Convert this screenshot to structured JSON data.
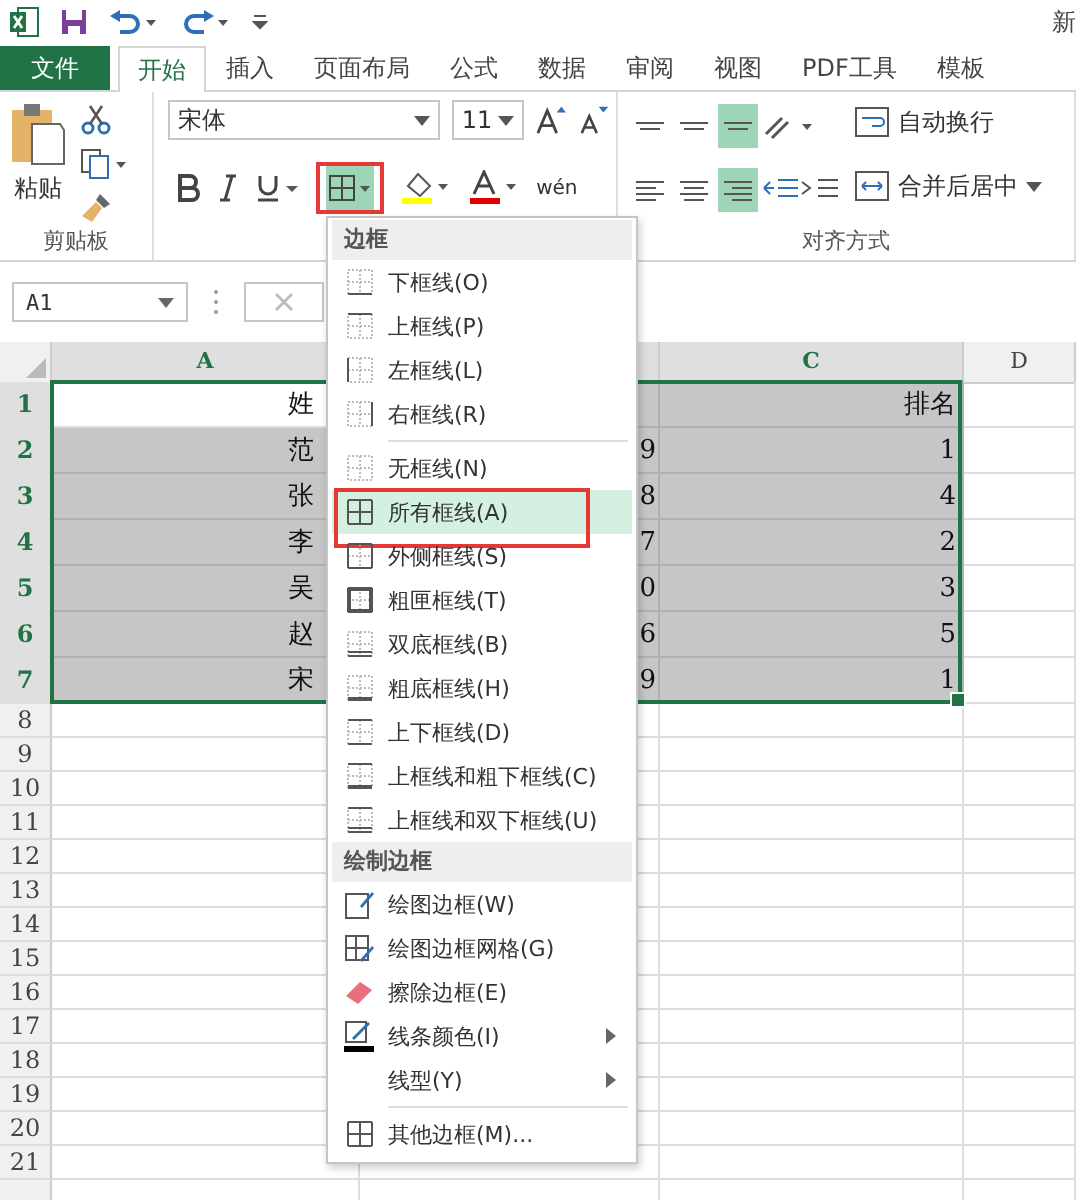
{
  "title_bar": {
    "title": "新"
  },
  "ribbon_tabs": [
    {
      "label": "文件",
      "kind": "file",
      "selected": false
    },
    {
      "label": "开始",
      "kind": "tab",
      "selected": true
    },
    {
      "label": "插入",
      "kind": "tab",
      "selected": false
    },
    {
      "label": "页面布局",
      "kind": "tab",
      "selected": false
    },
    {
      "label": "公式",
      "kind": "tab",
      "selected": false
    },
    {
      "label": "数据",
      "kind": "tab",
      "selected": false
    },
    {
      "label": "审阅",
      "kind": "tab",
      "selected": false
    },
    {
      "label": "视图",
      "kind": "tab",
      "selected": false
    },
    {
      "label": "PDF工具",
      "kind": "tab",
      "selected": false
    },
    {
      "label": "模板",
      "kind": "tab",
      "selected": false
    }
  ],
  "ribbon": {
    "paste_label": "粘贴",
    "clipboard_label": "剪贴板",
    "font_name": "宋体",
    "font_size": "11",
    "phonetic_label": "wén",
    "border_button": {
      "on": true,
      "marked": true
    },
    "align_buttons": [
      {
        "kind": "top",
        "on": false
      },
      {
        "kind": "middle",
        "on": false
      },
      {
        "kind": "bottom",
        "on": true
      },
      {
        "kind": "left",
        "on": false
      },
      {
        "kind": "center",
        "on": false
      },
      {
        "kind": "right",
        "on": true
      }
    ],
    "wrap_text": "自动换行",
    "merge_center": "合并后居中",
    "alignment_label": "对齐方式"
  },
  "name_box": {
    "value": "A1"
  },
  "sheet": {
    "columns": [
      {
        "label": "A",
        "selected": true
      },
      {
        "selected": true
      },
      {
        "label": "C",
        "selected": true
      },
      {
        "label": "D",
        "selected": false
      }
    ],
    "rows": [
      {
        "label": "1",
        "selected": true,
        "cells": [
          {
            "text": "姓",
            "selected": false
          },
          {
            "selected": true
          },
          {
            "text": "排名",
            "selected": true
          }
        ]
      },
      {
        "label": "2",
        "selected": true,
        "cells": [
          {
            "text": "范",
            "selected": true
          },
          {
            "text": "9",
            "selected": true
          },
          {
            "text": "1",
            "selected": true
          }
        ]
      },
      {
        "label": "3",
        "selected": true,
        "cells": [
          {
            "text": "张",
            "selected": true
          },
          {
            "text": "8",
            "selected": true
          },
          {
            "text": "4",
            "selected": true
          }
        ]
      },
      {
        "label": "4",
        "selected": true,
        "cells": [
          {
            "text": "李",
            "selected": true
          },
          {
            "text": "7",
            "selected": true
          },
          {
            "text": "2",
            "selected": true
          }
        ]
      },
      {
        "label": "5",
        "selected": true,
        "cells": [
          {
            "text": "吴",
            "selected": true
          },
          {
            "text": "0",
            "selected": true
          },
          {
            "text": "3",
            "selected": true
          }
        ]
      },
      {
        "label": "6",
        "selected": true,
        "cells": [
          {
            "text": "赵",
            "selected": true
          },
          {
            "text": "6",
            "selected": true
          },
          {
            "text": "5",
            "selected": true
          }
        ]
      },
      {
        "label": "7",
        "selected": true,
        "cells": [
          {
            "text": "宋",
            "selected": true
          },
          {
            "text": "9",
            "selected": true
          },
          {
            "text": "1",
            "selected": true
          }
        ]
      },
      {
        "label": "8",
        "selected": false
      },
      {
        "label": "9",
        "selected": false
      },
      {
        "label": "10",
        "selected": false
      },
      {
        "label": "11",
        "selected": false
      },
      {
        "label": "12",
        "selected": false
      },
      {
        "label": "13",
        "selected": false
      },
      {
        "label": "14",
        "selected": false
      },
      {
        "label": "15",
        "selected": false
      },
      {
        "label": "16",
        "selected": false
      },
      {
        "label": "17",
        "selected": false
      },
      {
        "label": "18",
        "selected": false
      },
      {
        "label": "19",
        "selected": false
      },
      {
        "label": "20",
        "selected": false
      },
      {
        "label": "21",
        "selected": false
      }
    ]
  },
  "border_menu": [
    {
      "kind": "header",
      "label": "边框"
    },
    {
      "kind": "bottom",
      "label": "下框线(O)",
      "selected": false
    },
    {
      "kind": "top",
      "label": "上框线(P)",
      "selected": false
    },
    {
      "kind": "left",
      "label": "左框线(L)",
      "selected": false
    },
    {
      "kind": "right",
      "label": "右框线(R)",
      "selected": false
    },
    {
      "kind": "separator"
    },
    {
      "kind": "none",
      "label": "无框线(N)",
      "selected": false
    },
    {
      "kind": "all",
      "label": "所有框线(A)",
      "selected": true,
      "marked": true
    },
    {
      "kind": "outside",
      "label": "外侧框线(S)",
      "selected": false
    },
    {
      "kind": "thick_box",
      "label": "粗匣框线(T)",
      "selected": false
    },
    {
      "kind": "double_bottom",
      "label": "双底框线(B)",
      "selected": false
    },
    {
      "kind": "thick_bottom",
      "label": "粗底框线(H)",
      "selected": false
    },
    {
      "kind": "top_bottom",
      "label": "上下框线(D)",
      "selected": false
    },
    {
      "kind": "top_thick_bottom",
      "label": "上框线和粗下框线(C)",
      "selected": false
    },
    {
      "kind": "top_double_bottom",
      "label": "上框线和双下框线(U)",
      "selected": false
    },
    {
      "kind": "header",
      "label": "绘制边框"
    },
    {
      "kind": "draw_border",
      "label": "绘图边框(W)",
      "selected": false
    },
    {
      "kind": "draw_grid",
      "label": "绘图边框网格(G)",
      "selected": false
    },
    {
      "kind": "erase",
      "label": "擦除边框(E)",
      "selected": false
    },
    {
      "kind": "line_color",
      "label": "线条颜色(I)",
      "selected": false,
      "submenu": true
    },
    {
      "kind": "line_style",
      "label": "线型(Y)",
      "selected": false,
      "submenu": true
    },
    {
      "kind": "separator"
    },
    {
      "kind": "all",
      "label": "其他边框(M)...",
      "selected": false
    }
  ]
}
